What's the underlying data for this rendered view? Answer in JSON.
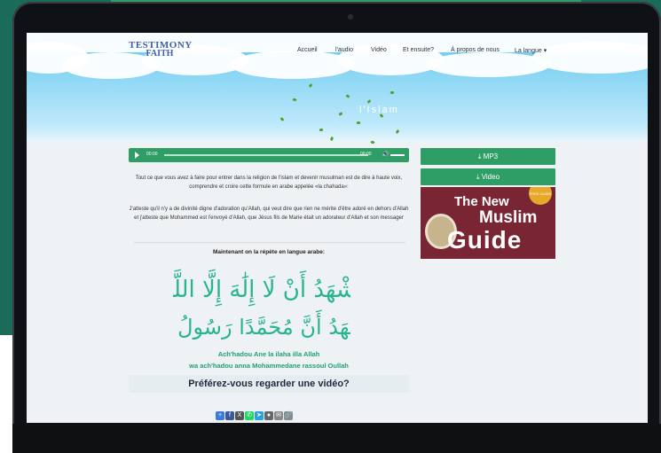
{
  "logo": {
    "line1": "TESTIMONY",
    "line2": "FAITH"
  },
  "nav": {
    "items": [
      {
        "label": "Accueil"
      },
      {
        "label": "l'audio"
      },
      {
        "label": "Vidéo"
      },
      {
        "label": "Et ensuite?"
      },
      {
        "label": "À propos de nous"
      },
      {
        "label": "La langue ▾"
      }
    ]
  },
  "hero": {
    "title": "l'Islam"
  },
  "player": {
    "current": "00:00",
    "duration": "00:00"
  },
  "content": {
    "intro": "Tout ce que vous avez à faire pour entrer dans la religion de l'islam et devenir musulman est de dire à haute voix, comprendre et croire cette formule en arabe appelée «la chahada»:",
    "testimony": "J'atteste qu'il n'y a de divinité digne d'adoration qu'Allah, qui veut dire que rien ne mérite d'être adoré en dehors d'Allah et j'atteste que Mohammed est l'envoyé d'Allah, que Jésus fils de Marie était un adorateur d'Allah et son messager",
    "repeat_label": "Maintenant on la répète en langue arabe:",
    "arabic_line1": "أَشْهَدُ أَنْ لَا إِلَٰهَ إِلَّا اللَّهُ",
    "arabic_line2": "وَأَشْهَدُ أَنَّ مُحَمَّدًا رَسُولُ اللَّهِ",
    "translit_1": "Ach'hadou Ane la ilaha illa Allah",
    "translit_2": "wa ach'hadou anna Mohammedane rassoul Oullah",
    "video_prompt": "Préférez-vous regarder une vidéo?"
  },
  "sidebar": {
    "mp3_label": "⤓ MP3",
    "video_label": "⤓ Video",
    "ad": {
      "line1": "The New",
      "line2": "Muslim",
      "line3": "Guide",
      "badge": "FREE GUIDE"
    }
  },
  "share": {
    "icons": [
      {
        "name": "add-share-icon",
        "glyph": "+",
        "color": "#3d7bd9"
      },
      {
        "name": "facebook-icon",
        "glyph": "f",
        "color": "#3b5998"
      },
      {
        "name": "x-icon",
        "glyph": "X",
        "color": "#555555"
      },
      {
        "name": "whatsapp-icon",
        "glyph": "✆",
        "color": "#25d366"
      },
      {
        "name": "telegram-icon",
        "glyph": "➤",
        "color": "#2aa1da"
      },
      {
        "name": "snapchat-icon",
        "glyph": "●",
        "color": "#666666"
      },
      {
        "name": "email-icon",
        "glyph": "✉",
        "color": "#888888"
      },
      {
        "name": "link-icon",
        "glyph": "🔗",
        "color": "#8a8a8a"
      }
    ]
  }
}
